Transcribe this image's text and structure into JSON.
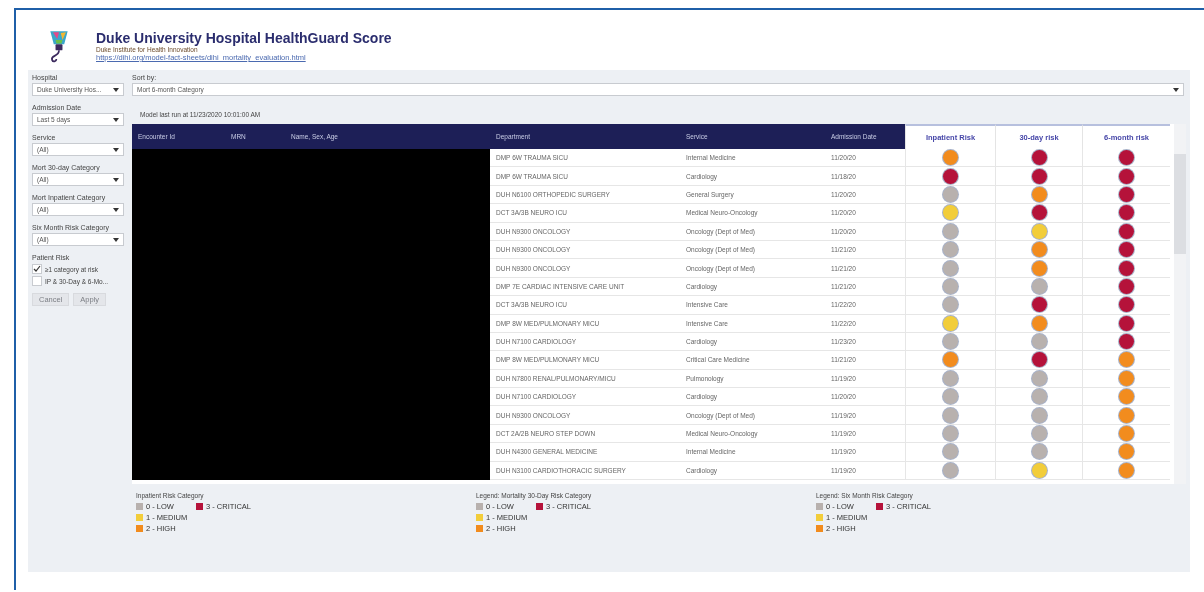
{
  "header": {
    "title": "Duke University Hospital HealthGuard Score",
    "subtitle": "Duke Institute for Health Innovation",
    "link": "https://dihi.org/model-fact-sheets/dihi_mortality_evaluation.html"
  },
  "filters": [
    {
      "label": "Hospital",
      "value": "Duke University Hos..."
    },
    {
      "label": "Admission Date",
      "value": "Last 5 days"
    },
    {
      "label": "Service",
      "value": "(All)"
    },
    {
      "label": "Mort 30-day Category",
      "value": "(All)"
    },
    {
      "label": "Mort Inpatient Category",
      "value": "(All)"
    },
    {
      "label": "Six Month Risk Category",
      "value": "(All)"
    }
  ],
  "patient_risk": {
    "label": "Patient Risk",
    "options": [
      {
        "label": "≥1 category at risk",
        "checked": true
      },
      {
        "label": "IP & 30-Day & 6-Mo...",
        "checked": false
      }
    ]
  },
  "buttons": [
    {
      "label": "Cancel",
      "disabled": true
    },
    {
      "label": "Apply",
      "disabled": true
    }
  ],
  "sort": {
    "label": "Sort by:",
    "value": "Mort 6-month Category"
  },
  "model_run": "Model last run at 11/23/2020 10:01:00 AM",
  "table": {
    "columns": [
      "Encounter Id",
      "MRN",
      "Name, Sex, Age",
      "Department",
      "Service",
      "Admission Date",
      "Inpatient Risk",
      "30-day risk",
      "6-month risk"
    ],
    "rows": [
      {
        "department": "DMP 6W TRAUMA SICU",
        "service": "Internal Medicine",
        "admission_date": "11/20/20",
        "risks": [
          {
            "color": "#f28c1e"
          },
          {
            "color": "#b5123a"
          },
          {
            "color": "#b5123a"
          }
        ]
      },
      {
        "department": "DMP 6W TRAUMA SICU",
        "service": "Cardiology",
        "admission_date": "11/18/20",
        "risks": [
          {
            "color": "#b5123a"
          },
          {
            "color": "#b5123a"
          },
          {
            "color": "#b5123a"
          }
        ]
      },
      {
        "department": "DUH N6100 ORTHOPEDIC SURGERY",
        "service": "General Surgery",
        "admission_date": "11/20/20",
        "risks": [
          {
            "color": "#b8b1ae"
          },
          {
            "color": "#f28c1e"
          },
          {
            "color": "#b5123a"
          }
        ]
      },
      {
        "department": "DCT 3A/3B NEURO ICU",
        "service": "Medical Neuro-Oncology",
        "admission_date": "11/20/20",
        "risks": [
          {
            "color": "#f2cd3a"
          },
          {
            "color": "#b5123a"
          },
          {
            "color": "#b5123a"
          }
        ]
      },
      {
        "department": "DUH N9300 ONCOLOGY",
        "service": "Oncology (Dept of Med)",
        "admission_date": "11/20/20",
        "risks": [
          {
            "color": "#b8b1ae"
          },
          {
            "color": "#f2cd3a"
          },
          {
            "color": "#b5123a"
          }
        ]
      },
      {
        "department": "DUH N9300 ONCOLOGY",
        "service": "Oncology (Dept of Med)",
        "admission_date": "11/21/20",
        "risks": [
          {
            "color": "#b8b1ae"
          },
          {
            "color": "#f28c1e"
          },
          {
            "color": "#b5123a"
          }
        ]
      },
      {
        "department": "DUH N9300 ONCOLOGY",
        "service": "Oncology (Dept of Med)",
        "admission_date": "11/21/20",
        "risks": [
          {
            "color": "#b8b1ae"
          },
          {
            "color": "#f28c1e"
          },
          {
            "color": "#b5123a"
          }
        ]
      },
      {
        "department": "DMP 7E CARDIAC INTENSIVE CARE UNIT",
        "service": "Cardiology",
        "admission_date": "11/21/20",
        "risks": [
          {
            "color": "#b8b1ae"
          },
          {
            "color": "#b8b1ae"
          },
          {
            "color": "#b5123a"
          }
        ]
      },
      {
        "department": "DCT 3A/3B NEURO ICU",
        "service": "Intensive Care",
        "admission_date": "11/22/20",
        "risks": [
          {
            "color": "#b8b1ae"
          },
          {
            "color": "#b5123a"
          },
          {
            "color": "#b5123a"
          }
        ]
      },
      {
        "department": "DMP 8W MED/PULMONARY MICU",
        "service": "Intensive Care",
        "admission_date": "11/22/20",
        "risks": [
          {
            "color": "#f2cd3a"
          },
          {
            "color": "#f28c1e"
          },
          {
            "color": "#b5123a"
          }
        ]
      },
      {
        "department": "DUH N7100 CARDIOLOGY",
        "service": "Cardiology",
        "admission_date": "11/23/20",
        "risks": [
          {
            "color": "#b8b1ae"
          },
          {
            "color": "#b8b1ae"
          },
          {
            "color": "#b5123a"
          }
        ]
      },
      {
        "department": "DMP 8W MED/PULMONARY MICU",
        "service": "Critical Care Medicine",
        "admission_date": "11/21/20",
        "risks": [
          {
            "color": "#f28c1e"
          },
          {
            "color": "#b5123a"
          },
          {
            "color": "#f28c1e"
          }
        ]
      },
      {
        "department": "DUH N7800 RENAL/PULMONARY/MICU",
        "service": "Pulmonology",
        "admission_date": "11/19/20",
        "risks": [
          {
            "color": "#b8b1ae"
          },
          {
            "color": "#b8b1ae"
          },
          {
            "color": "#f28c1e"
          }
        ]
      },
      {
        "department": "DUH N7100 CARDIOLOGY",
        "service": "Cardiology",
        "admission_date": "11/20/20",
        "risks": [
          {
            "color": "#b8b1ae"
          },
          {
            "color": "#b8b1ae"
          },
          {
            "color": "#f28c1e"
          }
        ]
      },
      {
        "department": "DUH N9300 ONCOLOGY",
        "service": "Oncology (Dept of Med)",
        "admission_date": "11/19/20",
        "risks": [
          {
            "color": "#b8b1ae"
          },
          {
            "color": "#b8b1ae"
          },
          {
            "color": "#f28c1e"
          }
        ]
      },
      {
        "department": "DCT 2A/2B NEURO STEP DOWN",
        "service": "Medical Neuro-Oncology",
        "admission_date": "11/19/20",
        "risks": [
          {
            "color": "#b8b1ae"
          },
          {
            "color": "#b8b1ae"
          },
          {
            "color": "#f28c1e"
          }
        ]
      },
      {
        "department": "DUH N4300 GENERAL MEDICINE",
        "service": "Internal Medicine",
        "admission_date": "11/19/20",
        "risks": [
          {
            "color": "#b8b1ae"
          },
          {
            "color": "#b8b1ae"
          },
          {
            "color": "#f28c1e"
          }
        ]
      },
      {
        "department": "DUH N3100 CARDIOTHORACIC SURGERY",
        "service": "Cardiology",
        "admission_date": "11/19/20",
        "risks": [
          {
            "color": "#b8b1ae"
          },
          {
            "color": "#f2cd3a"
          },
          {
            "color": "#f28c1e"
          }
        ]
      }
    ]
  },
  "legends": [
    {
      "title": "Inpatient Risk Category",
      "items": [
        {
          "label": "0 - LOW",
          "color": "#b8b1ae"
        },
        {
          "label": "1 - MEDIUM",
          "color": "#f2cd3a"
        },
        {
          "label": "2 - HIGH",
          "color": "#f28c1e"
        },
        {
          "label": "3 - CRITICAL",
          "color": "#b5123a"
        }
      ]
    },
    {
      "title": "Legend: Mortality 30-Day Risk Category",
      "items": [
        {
          "label": "0 - LOW",
          "color": "#b8b1ae"
        },
        {
          "label": "1 - MEDIUM",
          "color": "#f2cd3a"
        },
        {
          "label": "2 - HIGH",
          "color": "#f28c1e"
        },
        {
          "label": "3 - CRITICAL",
          "color": "#b5123a"
        }
      ]
    },
    {
      "title": "Legend: Six Month Risk Category",
      "items": [
        {
          "label": "0 - LOW",
          "color": "#b8b1ae"
        },
        {
          "label": "1 - MEDIUM",
          "color": "#f2cd3a"
        },
        {
          "label": "2 - HIGH",
          "color": "#f28c1e"
        },
        {
          "label": "3 - CRITICAL",
          "color": "#b5123a"
        }
      ]
    }
  ]
}
